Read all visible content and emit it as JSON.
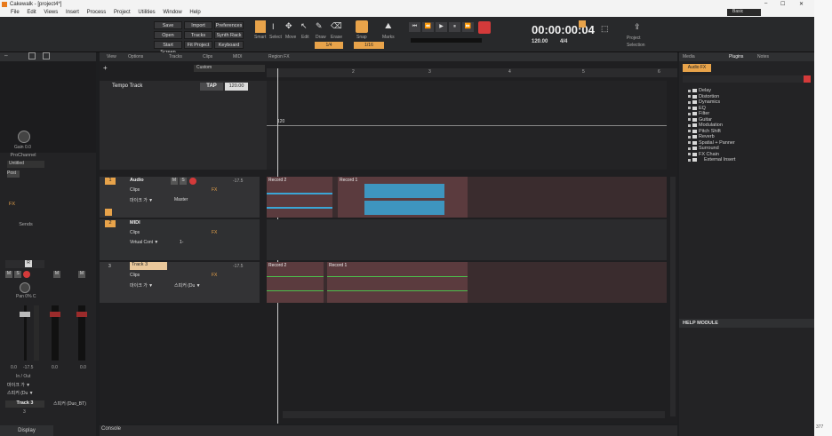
{
  "window": {
    "title": "Cakewalk - [project4*]",
    "min": "–",
    "max": "☐",
    "close": "✕"
  },
  "menu": [
    "File",
    "Edit",
    "Views",
    "Insert",
    "Process",
    "Project",
    "Utilities",
    "Window",
    "Help"
  ],
  "toolbar": {
    "file_buttons": [
      "Save",
      "Open",
      "Start Screen",
      "Import",
      "Tracks",
      "Fit Project",
      "Preferences",
      "Synth Rack",
      "Keyboard"
    ],
    "tools": [
      "Smart",
      "Select",
      "Move",
      "Edit",
      "Draw",
      "Erase"
    ],
    "snap": {
      "label": "Snap",
      "value": "1/4"
    },
    "marks": {
      "label": "Marks"
    },
    "grid_value": "1/16",
    "time": "00:00:00:04",
    "tempo": "120.00",
    "meter": "4/4",
    "project_option": "Project",
    "selection_option": "Selection",
    "preset": "Basic"
  },
  "view_menu": [
    "View",
    "Options",
    "Tracks",
    "Clips",
    "MIDI",
    "Region FX"
  ],
  "lane_dropdown": "Custom",
  "tempo_track": {
    "label": "Tempo Track",
    "tap": "TAP",
    "value": "120.00",
    "marker": "120"
  },
  "ruler_numbers": [
    "2",
    "3",
    "4",
    "5",
    "6"
  ],
  "tracks": [
    {
      "num": "1",
      "name": "Audio",
      "vol": "-17.5",
      "clips": "Clips",
      "input": "마이크 가 ▼",
      "output": "Master",
      "fx": "FX",
      "badge": "M S ● ◀"
    },
    {
      "num": "2",
      "name": "MIDI",
      "clips": "Clips",
      "input": "Virtual Cont ▼",
      "output": "1-",
      "fx": "FX"
    },
    {
      "num": "3",
      "name": "Track 3",
      "vol": "-17.5",
      "clips": "Clips",
      "input": "마이크 가 ▼",
      "output": "스피커 (Du ▼",
      "fx": "FX"
    }
  ],
  "clips": {
    "t1a": "Record 2",
    "t1b": "Record 1",
    "t3a": "Record 2",
    "t3b": "Record 1"
  },
  "inspector": {
    "gain": "Gain 0.0",
    "channel": "ProChannel",
    "preset": "Untitled",
    "post": "Post",
    "fx": "FX",
    "sends": "Sends",
    "pan": "Pan 0% C",
    "vol_left": "0.0",
    "vol_mid": "-17.5",
    "vol_mid2": "0.0",
    "vol_right": "0.0",
    "inout": "In / Out",
    "in_val": "마이크 가 ▼",
    "out_val": "스피커 (Du ▼",
    "track_name": "Track 3",
    "track_num": "3",
    "speaker": "스피커 (Duo_BT)",
    "display": "Display"
  },
  "browser": {
    "tabs": [
      "Media",
      "Plugins",
      "Notes"
    ],
    "category": "Audio FX",
    "items": [
      "Delay",
      "Distortion",
      "Dynamics",
      "EQ",
      "Filter",
      "Guitar",
      "Modulation",
      "Pitch Shift",
      "Reverb",
      "Spatial + Panner",
      "Surround",
      "FX Chain",
      "External Insert"
    ],
    "help": "HELP MODULE"
  },
  "console_tab": "Console",
  "status": "377"
}
